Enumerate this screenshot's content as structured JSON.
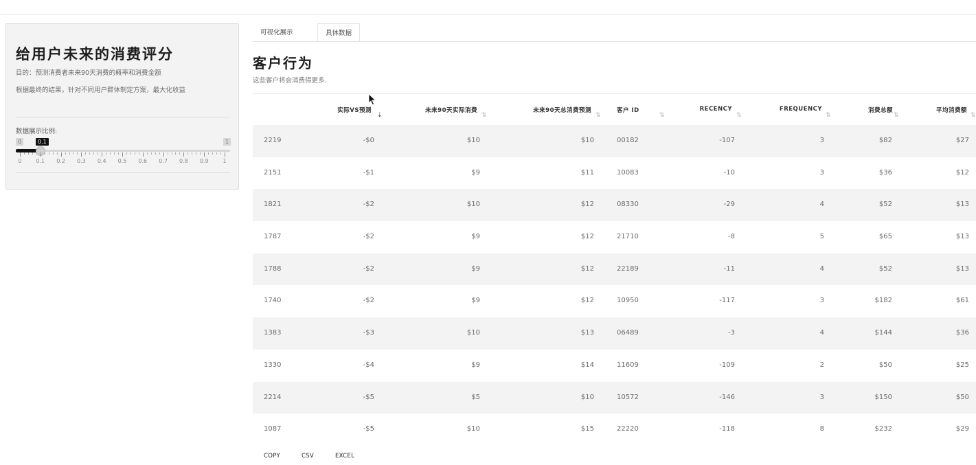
{
  "sidebar": {
    "title": "给用户未来的消费评分",
    "purpose": "目的：预测消费者未来90天消费的概率和消费金额",
    "description": "根据最终的结果，针对不同用户群体制定方案，最大化收益",
    "slider": {
      "label": "数据展示比例:",
      "min_label": "0",
      "max_label": "1",
      "value_label": "0.1",
      "value": 0.1,
      "ticks": [
        "0",
        "0.1",
        "0.2",
        "0.3",
        "0.4",
        "0.5",
        "0.6",
        "0.7",
        "0.8",
        "0.9",
        "1"
      ]
    }
  },
  "tabs": [
    {
      "label": "可视化展示",
      "active": false
    },
    {
      "label": "具体数据",
      "active": true
    }
  ],
  "main": {
    "title": "客户行为",
    "subtitle": "这些客户将会消费得更多."
  },
  "table": {
    "columns": [
      "",
      "实际VS预测",
      "未来90天实际消费",
      "未来90天总消费预测",
      "客户 ID",
      "RECENCY",
      "FREQUENCY",
      "消费总额",
      "平均消费额"
    ],
    "rows": [
      [
        "2219",
        "-$0",
        "$10",
        "$10",
        "00182",
        "-107",
        "3",
        "$82",
        "$27"
      ],
      [
        "2151",
        "-$1",
        "$9",
        "$11",
        "10083",
        "-10",
        "3",
        "$36",
        "$12"
      ],
      [
        "1821",
        "-$2",
        "$10",
        "$12",
        "08330",
        "-29",
        "4",
        "$52",
        "$13"
      ],
      [
        "1787",
        "-$2",
        "$9",
        "$12",
        "21710",
        "-8",
        "5",
        "$65",
        "$13"
      ],
      [
        "1788",
        "-$2",
        "$9",
        "$12",
        "22189",
        "-11",
        "4",
        "$52",
        "$13"
      ],
      [
        "1740",
        "-$2",
        "$9",
        "$12",
        "10950",
        "-117",
        "3",
        "$182",
        "$61"
      ],
      [
        "1383",
        "-$3",
        "$10",
        "$13",
        "06489",
        "-3",
        "4",
        "$144",
        "$36"
      ],
      [
        "1330",
        "-$4",
        "$9",
        "$14",
        "11609",
        "-109",
        "2",
        "$50",
        "$25"
      ],
      [
        "2214",
        "-$5",
        "$5",
        "$10",
        "10572",
        "-146",
        "3",
        "$150",
        "$50"
      ],
      [
        "1087",
        "-$5",
        "$10",
        "$15",
        "22220",
        "-118",
        "8",
        "$232",
        "$29"
      ]
    ],
    "buttons": [
      "COPY",
      "CSV",
      "EXCEL"
    ]
  }
}
